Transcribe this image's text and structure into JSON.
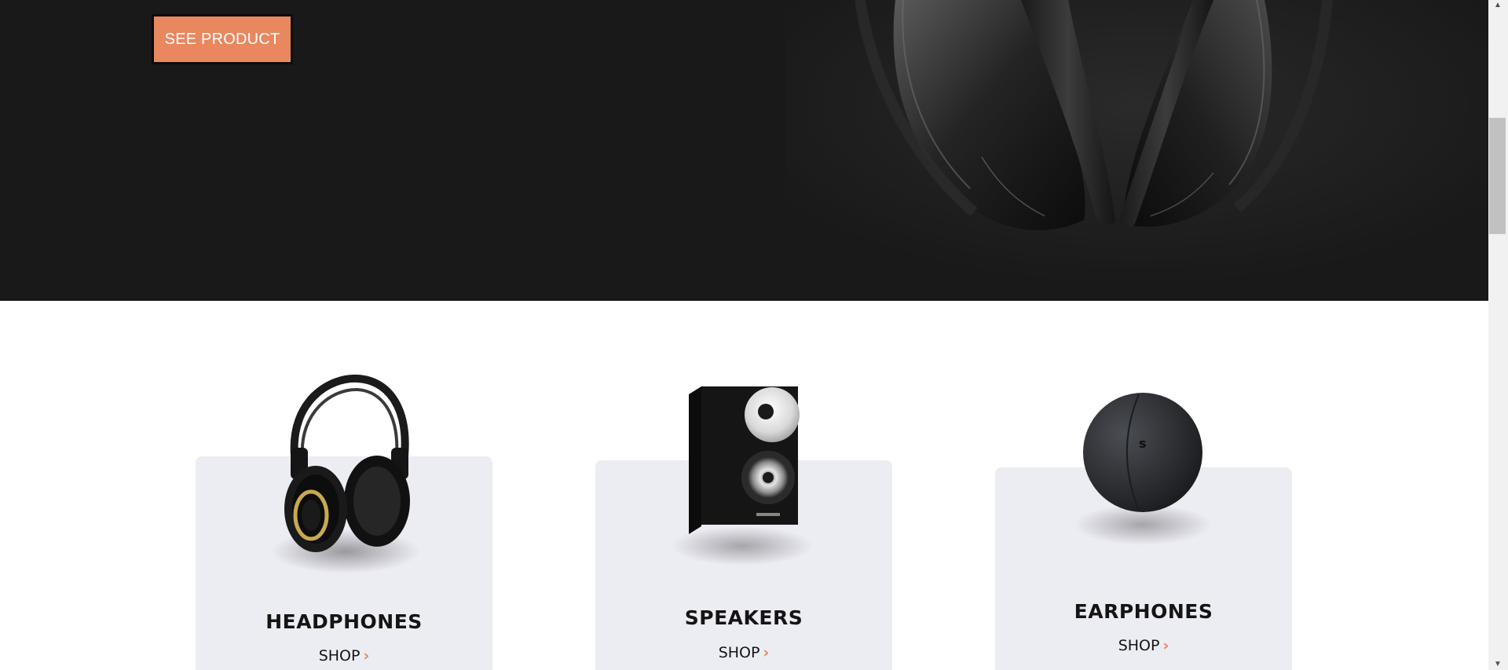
{
  "hero": {
    "button_label": "SEE PRODUCT"
  },
  "categories": [
    {
      "title": "HEADPHONES",
      "shop_label": "SHOP",
      "icon": "headphones-icon"
    },
    {
      "title": "SPEAKERS",
      "shop_label": "SHOP",
      "icon": "speaker-icon"
    },
    {
      "title": "EARPHONES",
      "shop_label": "SHOP",
      "icon": "earphones-case-icon"
    }
  ],
  "colors": {
    "hero_bg": "#191919",
    "accent": "#e9875f",
    "card_bg": "#ececf3",
    "text_dark": "#141414"
  }
}
